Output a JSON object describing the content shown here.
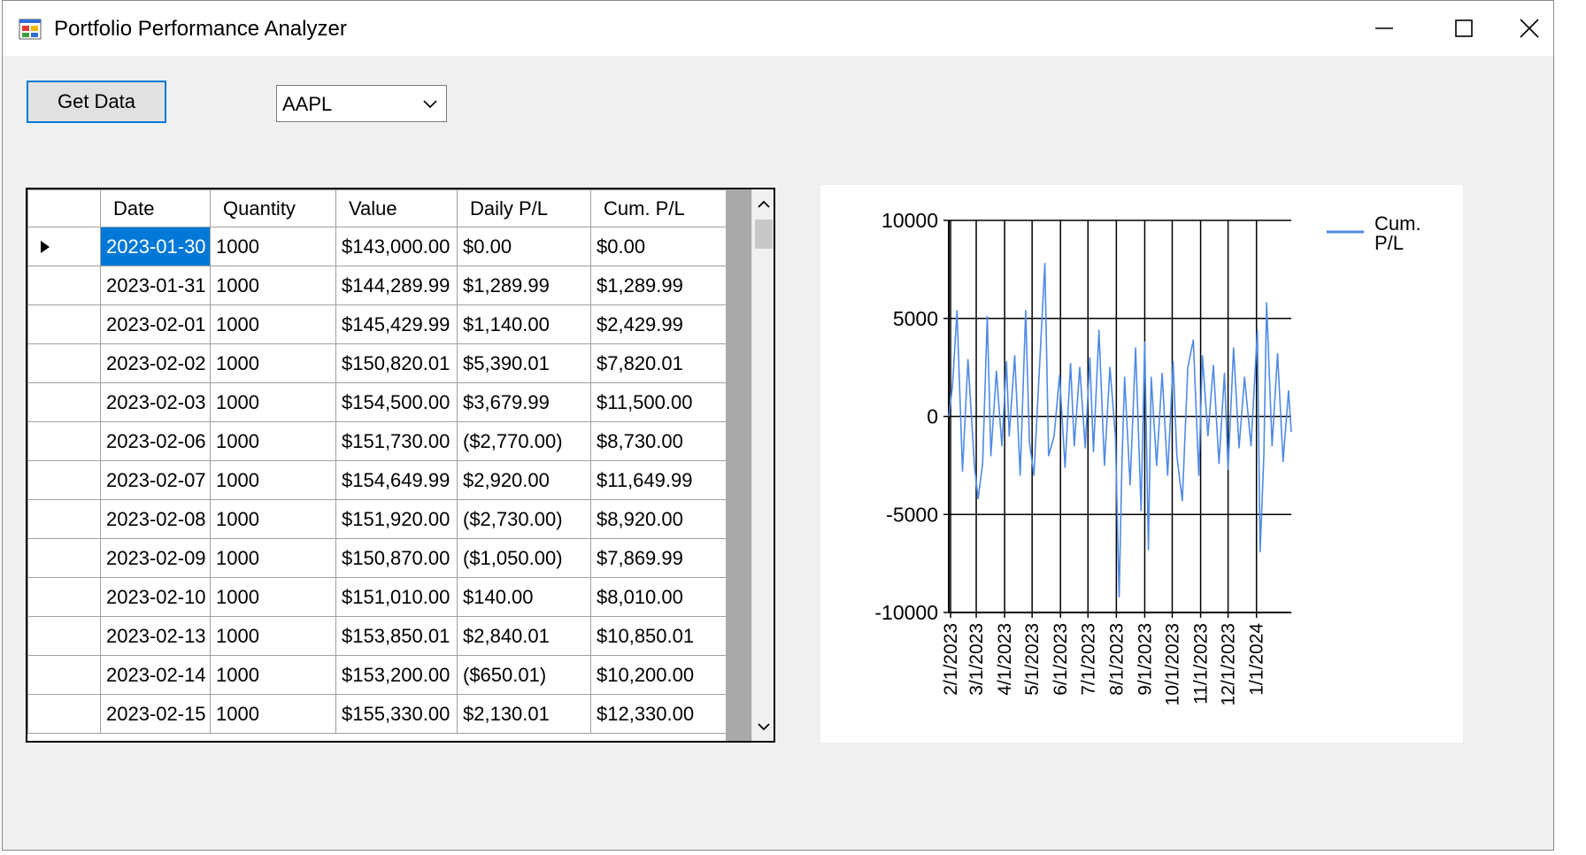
{
  "window": {
    "title": "Portfolio Performance Analyzer"
  },
  "toolbar": {
    "get_data_label": "Get Data",
    "ticker_selected": "AAPL"
  },
  "grid": {
    "columns": [
      "Date",
      "Quantity",
      "Value",
      "Daily P/L",
      "Cum. P/L"
    ],
    "rows": [
      [
        "2023-01-30",
        "1000",
        "$143,000.00",
        "$0.00",
        "$0.00"
      ],
      [
        "2023-01-31",
        "1000",
        "$144,289.99",
        "$1,289.99",
        "$1,289.99"
      ],
      [
        "2023-02-01",
        "1000",
        "$145,429.99",
        "$1,140.00",
        "$2,429.99"
      ],
      [
        "2023-02-02",
        "1000",
        "$150,820.01",
        "$5,390.01",
        "$7,820.01"
      ],
      [
        "2023-02-03",
        "1000",
        "$154,500.00",
        "$3,679.99",
        "$11,500.00"
      ],
      [
        "2023-02-06",
        "1000",
        "$151,730.00",
        "($2,770.00)",
        "$8,730.00"
      ],
      [
        "2023-02-07",
        "1000",
        "$154,649.99",
        "$2,920.00",
        "$11,649.99"
      ],
      [
        "2023-02-08",
        "1000",
        "$151,920.00",
        "($2,730.00)",
        "$8,920.00"
      ],
      [
        "2023-02-09",
        "1000",
        "$150,870.00",
        "($1,050.00)",
        "$7,869.99"
      ],
      [
        "2023-02-10",
        "1000",
        "$151,010.00",
        "$140.00",
        "$8,010.00"
      ],
      [
        "2023-02-13",
        "1000",
        "$153,850.01",
        "$2,840.01",
        "$10,850.01"
      ],
      [
        "2023-02-14",
        "1000",
        "$153,200.00",
        "($650.01)",
        "$10,200.00"
      ],
      [
        "2023-02-15",
        "1000",
        "$155,330.00",
        "$2,130.01",
        "$12,330.00"
      ]
    ]
  },
  "chart_data": {
    "type": "line",
    "ylim": [
      -10000,
      10000
    ],
    "y_ticks": [
      {
        "value": 10000,
        "label": "10000"
      },
      {
        "value": 5000,
        "label": "5000"
      },
      {
        "value": 0,
        "label": "0"
      },
      {
        "value": -5000,
        "label": "-5000"
      },
      {
        "value": -10000,
        "label": "-10000"
      }
    ],
    "x_range": [
      "2023-01-30",
      "2024-02-08"
    ],
    "x_ticks": [
      {
        "date": "2023-02-01",
        "label": "2/1/2023"
      },
      {
        "date": "2023-03-01",
        "label": "3/1/2023"
      },
      {
        "date": "2023-04-01",
        "label": "4/1/2023"
      },
      {
        "date": "2023-05-01",
        "label": "5/1/2023"
      },
      {
        "date": "2023-06-01",
        "label": "6/1/2023"
      },
      {
        "date": "2023-07-01",
        "label": "7/1/2023"
      },
      {
        "date": "2023-08-01",
        "label": "8/1/2023"
      },
      {
        "date": "2023-09-01",
        "label": "9/1/2023"
      },
      {
        "date": "2023-10-01",
        "label": "10/1/2023"
      },
      {
        "date": "2023-11-01",
        "label": "11/1/2023"
      },
      {
        "date": "2023-12-01",
        "label": "12/1/2023"
      },
      {
        "date": "2024-01-01",
        "label": "1/1/2024"
      }
    ],
    "grid": true,
    "legend": "top-right",
    "series": [
      {
        "name": "Cum. P/L",
        "color": "#4f8ae6",
        "x": [
          "2023-01-30",
          "2023-02-03",
          "2023-02-08",
          "2023-02-14",
          "2023-02-20",
          "2023-02-27",
          "2023-03-03",
          "2023-03-08",
          "2023-03-13",
          "2023-03-17",
          "2023-03-23",
          "2023-03-29",
          "2023-04-03",
          "2023-04-06",
          "2023-04-12",
          "2023-04-18",
          "2023-04-24",
          "2023-04-28",
          "2023-05-03",
          "2023-05-09",
          "2023-05-15",
          "2023-05-19",
          "2023-05-25",
          "2023-05-31",
          "2023-06-06",
          "2023-06-12",
          "2023-06-16",
          "2023-06-22",
          "2023-06-28",
          "2023-07-03",
          "2023-07-07",
          "2023-07-13",
          "2023-07-19",
          "2023-07-25",
          "2023-07-31",
          "2023-08-04",
          "2023-08-07",
          "2023-08-10",
          "2023-08-16",
          "2023-08-22",
          "2023-08-28",
          "2023-09-01",
          "2023-09-05",
          "2023-09-08",
          "2023-09-14",
          "2023-09-20",
          "2023-09-26",
          "2023-10-02",
          "2023-10-06",
          "2023-10-12",
          "2023-10-18",
          "2023-10-24",
          "2023-10-30",
          "2023-11-03",
          "2023-11-09",
          "2023-11-15",
          "2023-11-21",
          "2023-11-27",
          "2023-12-01",
          "2023-12-07",
          "2023-12-13",
          "2023-12-19",
          "2023-12-26",
          "2024-01-02",
          "2024-01-05",
          "2024-01-09",
          "2024-01-12",
          "2024-01-18",
          "2024-01-24",
          "2024-01-30",
          "2024-02-05",
          "2024-02-08"
        ],
        "values": [
          0,
          1500,
          5400,
          -2800,
          2900,
          -2500,
          -4200,
          -2400,
          5100,
          -2000,
          2300,
          -1500,
          2800,
          -1000,
          3100,
          -3000,
          5400,
          -1300,
          -3000,
          2400,
          7800,
          -2000,
          -1000,
          2100,
          -2600,
          2700,
          -1500,
          2500,
          -1600,
          3000,
          -1800,
          4400,
          -2500,
          2500,
          -1000,
          -9200,
          -2500,
          2000,
          -3500,
          3500,
          -4800,
          3800,
          -6800,
          2000,
          -2500,
          2200,
          -3000,
          2800,
          -2000,
          -4300,
          2500,
          3900,
          -3000,
          3100,
          -1000,
          2600,
          -2400,
          2200,
          -2700,
          3500,
          -1600,
          2000,
          -1500,
          4400,
          -6900,
          -2000,
          5800,
          -1500,
          3200,
          -2300,
          1300,
          -800
        ]
      }
    ]
  }
}
